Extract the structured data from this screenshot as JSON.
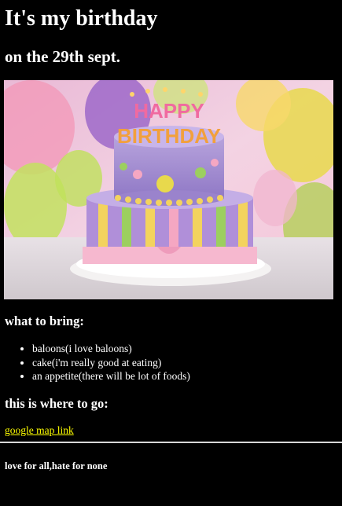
{
  "header": {
    "title": "It's my birthday",
    "subtitle": "on the 29th sept."
  },
  "hero_image": {
    "description_icon": "birthday-cake-image",
    "topper_line1": "HAPPY",
    "topper_line2": "BIRTHDAY"
  },
  "bring": {
    "heading": "what to bring:",
    "items": [
      "baloons(i love baloons)",
      "cake(i'm really good at eating)",
      "an appetite(there will be lot of foods)"
    ]
  },
  "location": {
    "heading": "this is where to go:",
    "link_text": "google map link",
    "link_color": "#ffff00"
  },
  "footer": {
    "text": "love for all,hate for none"
  }
}
